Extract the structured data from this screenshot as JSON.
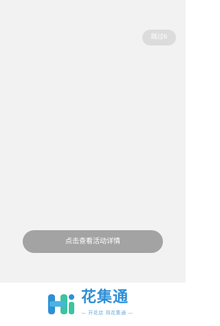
{
  "splash": {
    "skip_label": "跳过6",
    "detail_button_label": "点击查看活动详情"
  },
  "footer": {
    "brand_name": "花集通",
    "slogan": "— 开花店  用花集通 —"
  },
  "colors": {
    "brand_blue": "#2e8fd6",
    "brand_green": "#3cc3a0",
    "button_gray": "#a3a3a3"
  }
}
